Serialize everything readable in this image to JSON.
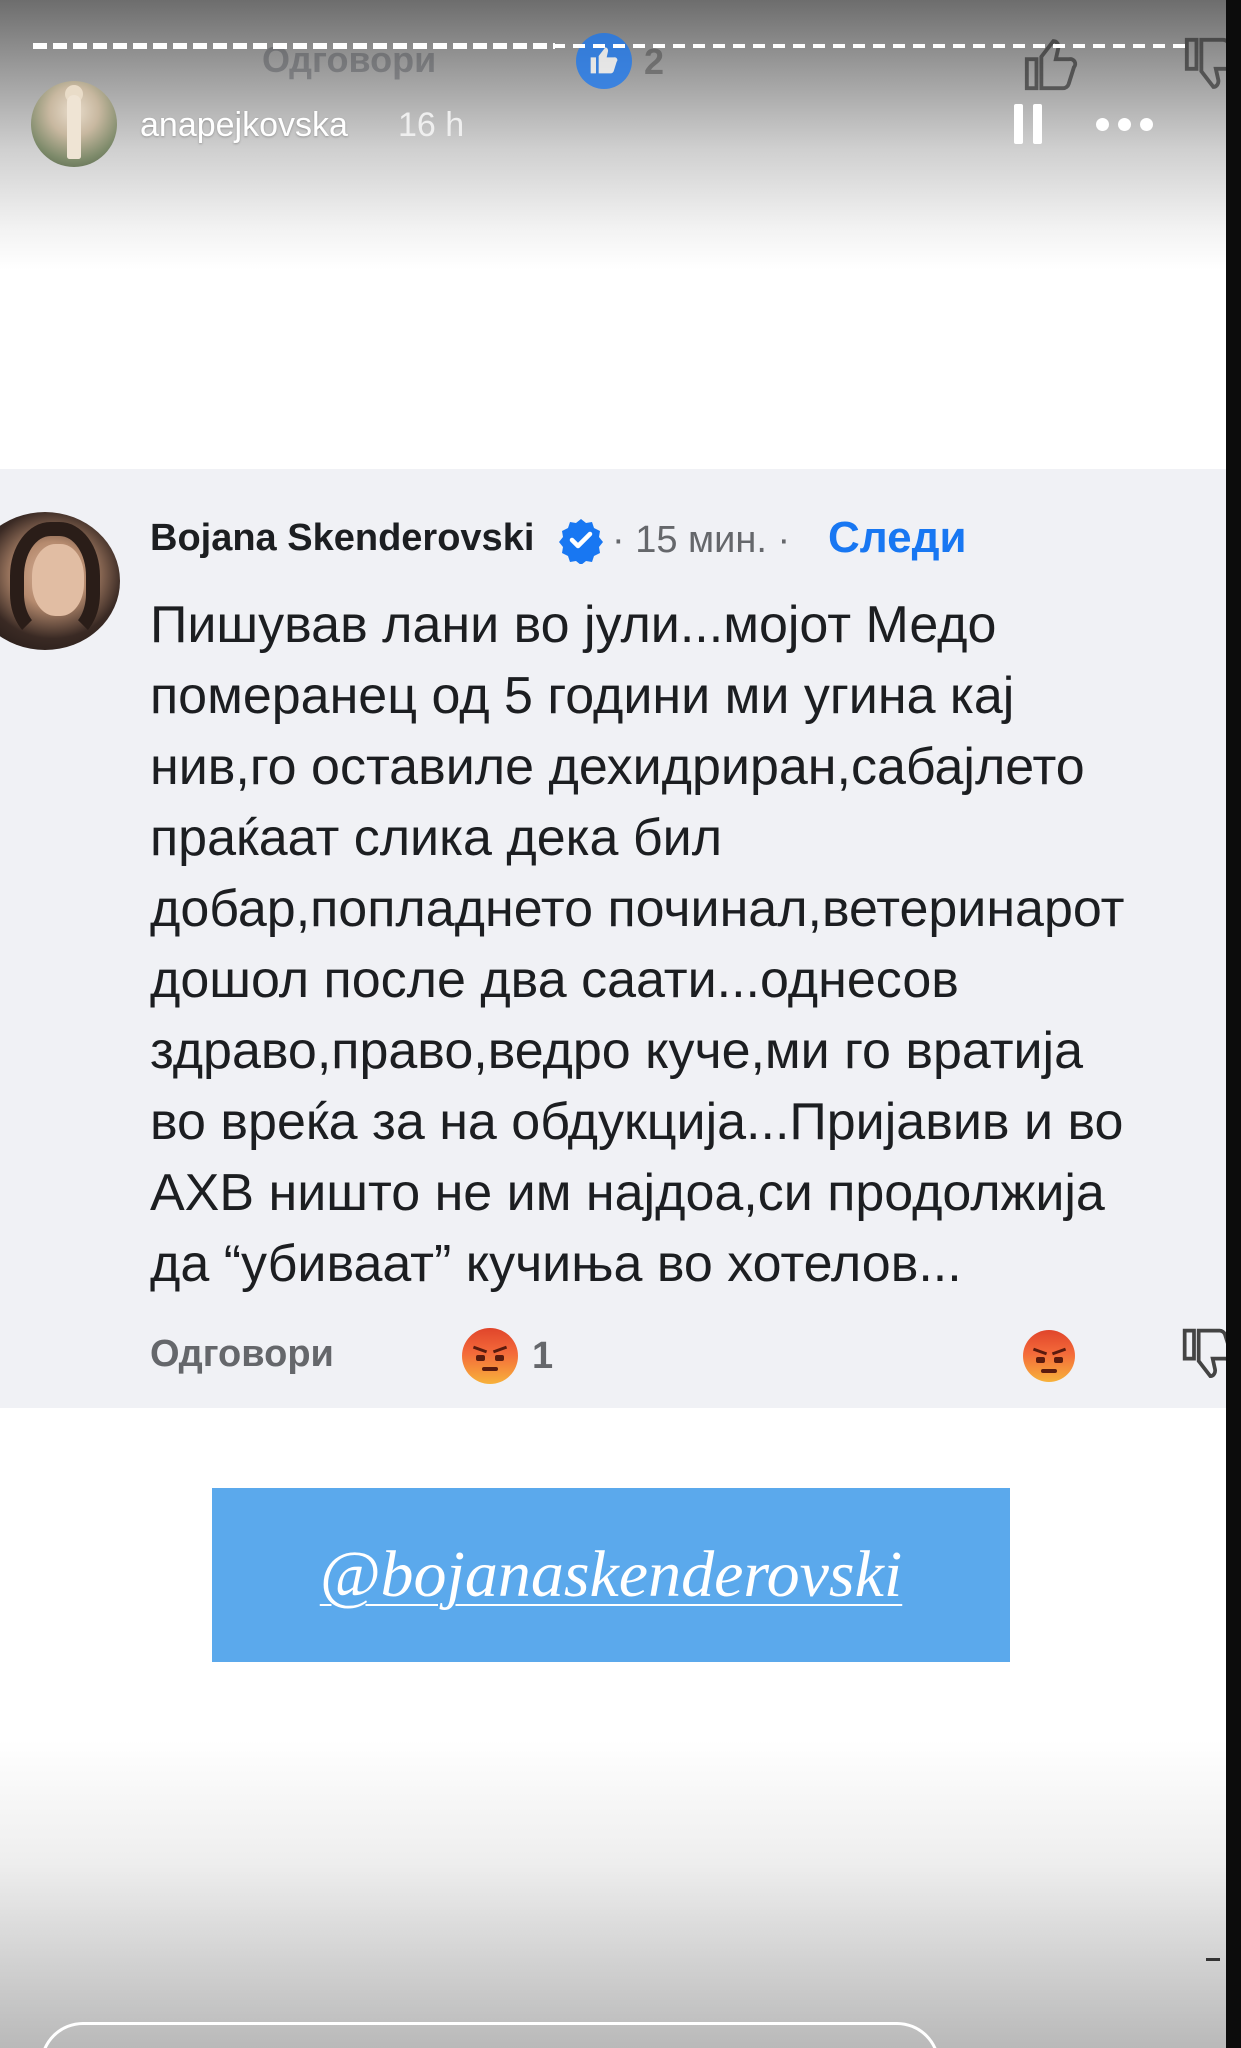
{
  "story": {
    "username": "anapejkovska",
    "time_ago": "16 h",
    "progress_fraction": 0.45
  },
  "background_row": {
    "reply_label": "Одговори",
    "like_count": "2"
  },
  "comment": {
    "author": "Bojana Skenderovski",
    "meta": "· 15 мин. ·",
    "follow_label": "Следи",
    "text": "Пишував лани во јули...мојот Медо\nпомеранец од 5 години ми угина кај\nнив,го оставиле дехидриран,сабајлето\nпраќаат слика дека бил\nдобар,попладнето починал,ветеринарот\nдошол после два саати...однесов\nздраво,право,ведро куче,ми го вратија\nво вреќа за на обдукција...Пријавив и во\nАХВ ништо не им најдоа,си продолжија\nда “убиваат” кучиња во хотелов...",
    "reply_label": "Одговори",
    "reaction_count": "1"
  },
  "mention": {
    "text": "@bojanaskenderovski"
  },
  "colors": {
    "facebook_blue": "#1877f2",
    "mention_bg": "#5ba9ec",
    "card_bg": "#f0f1f5"
  },
  "icons": [
    "pause-icon",
    "more-icon",
    "verified-icon",
    "angry-reaction-icon",
    "thumbs-up-icon",
    "thumbs-down-icon"
  ]
}
